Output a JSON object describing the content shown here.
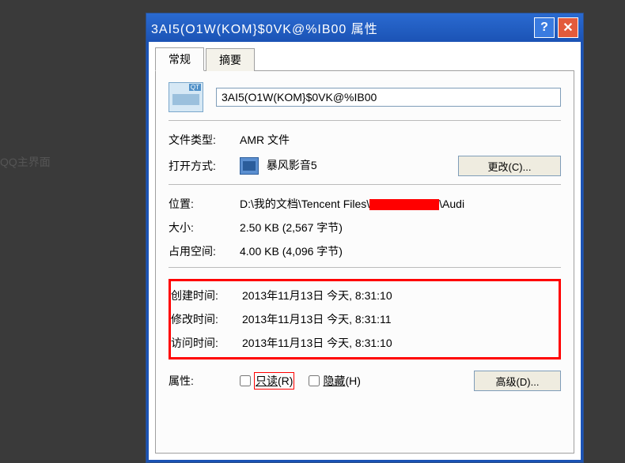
{
  "background": {
    "left_label": "QQ主界面"
  },
  "titlebar": {
    "title": "3AI5(O1W(KOM}$0VK@%IB00 属性",
    "help_symbol": "?",
    "close_symbol": "✕"
  },
  "tabs": {
    "active": "常规",
    "tab2": "摘要"
  },
  "file": {
    "name": "3AI5(O1W(KOM}$0VK@%IB00",
    "type_label": "文件类型:",
    "type_value": "AMR 文件",
    "openwith_label": "打开方式:",
    "openwith_value": "暴风影音5",
    "change_btn": "更改(C)...",
    "location_label": "位置:",
    "location_prefix": "D:\\我的文档\\Tencent Files\\",
    "location_suffix": "\\Audi",
    "size_label": "大小:",
    "size_value": "2.50 KB (2,567 字节)",
    "disk_label": "占用空间:",
    "disk_value": "4.00 KB (4,096 字节)"
  },
  "dates": {
    "created_label": "创建时间:",
    "created_value": "2013年11月13日 今天, 8:31:10",
    "modified_label": "修改时间:",
    "modified_value": "2013年11月13日 今天, 8:31:11",
    "accessed_label": "访问时间:",
    "accessed_value": "2013年11月13日 今天, 8:31:10"
  },
  "attrs": {
    "label": "属性:",
    "readonly_text": "只读",
    "readonly_key": "(R)",
    "hidden_text": "隐藏",
    "hidden_key": "(H)",
    "advanced_btn": "高级(D)..."
  }
}
